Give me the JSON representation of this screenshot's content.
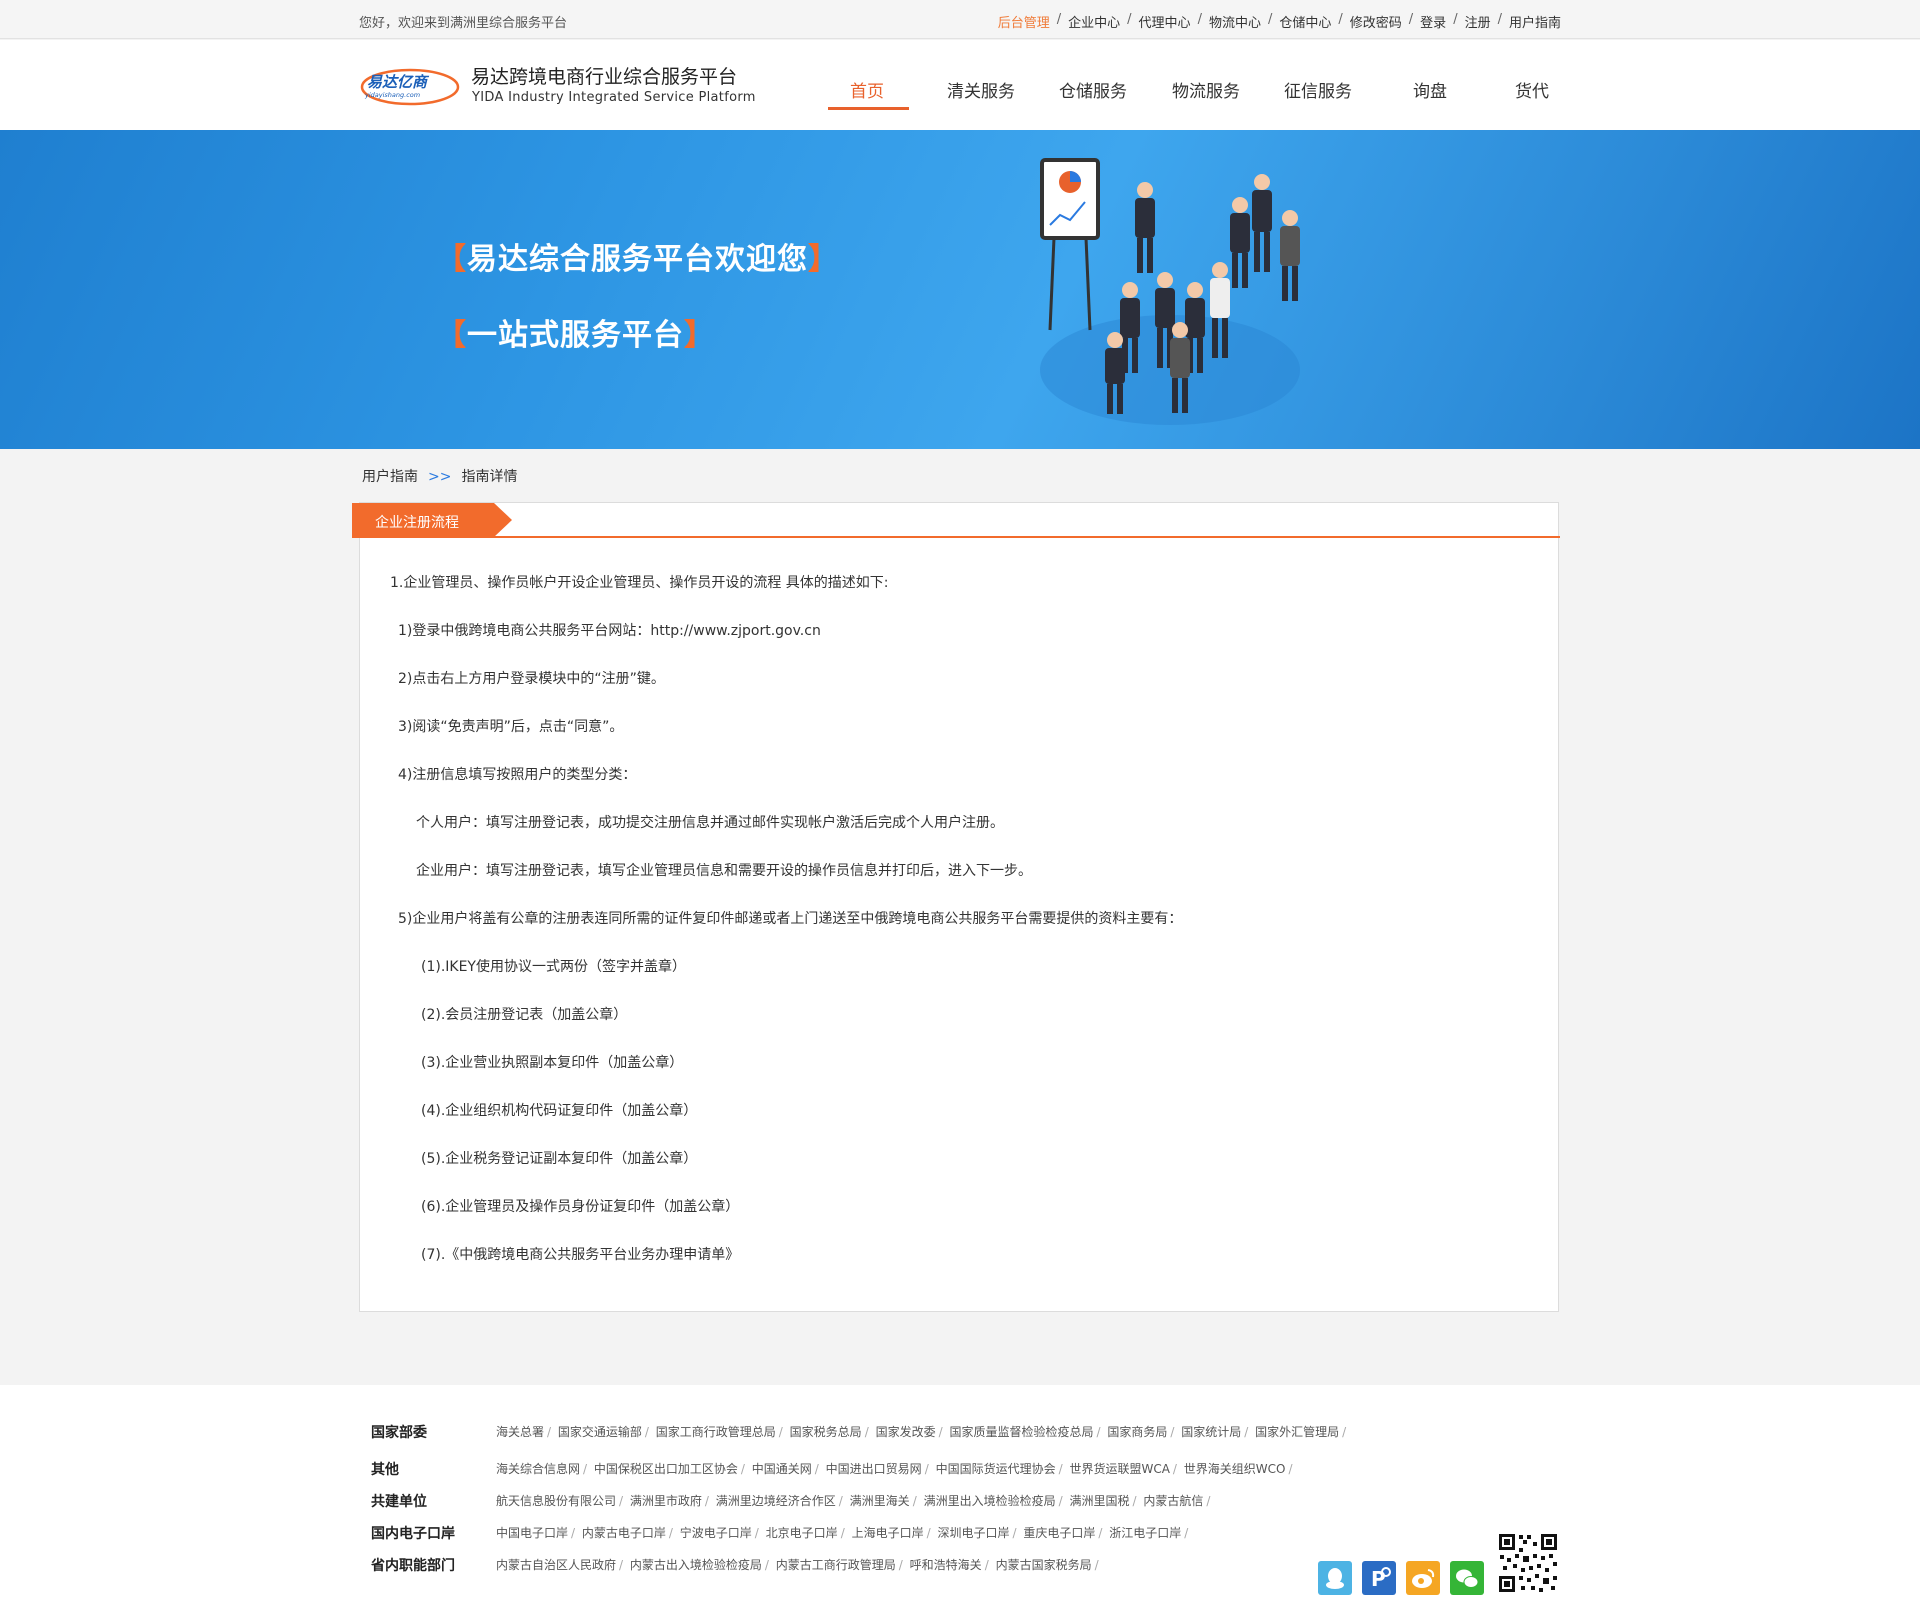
{
  "topbar": {
    "welcome": "您好，欢迎来到满洲里综合服务平台",
    "links": [
      "后台管理",
      "企业中心",
      "代理中心",
      "物流中心",
      "仓储中心",
      "修改密码",
      "登录",
      "注册",
      "用户指南"
    ],
    "active_link_color": "#f07b39"
  },
  "header": {
    "logo_text": "易达亿商",
    "logo_sub": "yidayishang.com",
    "brand_cn": "易达跨境电商行业综合服务平台",
    "brand_en": "YIDA  Industry Integrated Service Platform",
    "nav": [
      "首页",
      "清关服务",
      "仓储服务",
      "物流服务",
      "征信服务",
      "询盘",
      "货代"
    ],
    "active_nav": "首页",
    "accent_color": "#e8612c"
  },
  "banner": {
    "line1": "易达综合服务平台欢迎您",
    "line2": "一站式服务平台",
    "bracket_open": "【",
    "bracket_close": "】"
  },
  "breadcrumb": {
    "item1": "用户指南",
    "separator": ">>",
    "item2": "指南详情"
  },
  "article": {
    "tab_label": "企业注册流程",
    "lines": [
      "1.企业管理员、操作员帐户开设企业管理员、操作员开设的流程 具体的描述如下:",
      "1)登录中俄跨境电商公共服务平台网站：http://www.zjport.gov.cn",
      "2)点击右上方用户登录模块中的“注册”键。",
      "3)阅读“免责声明”后，点击“同意”。",
      "4)注册信息填写按照用户的类型分类：",
      "个人用户：填写注册登记表，成功提交注册信息并通过邮件实现帐户激活后完成个人用户注册。",
      "企业用户：填写注册登记表，填写企业管理员信息和需要开设的操作员信息并打印后，进入下一步。",
      "5)企业用户将盖有公章的注册表连同所需的证件复印件邮递或者上门递送至中俄跨境电商公共服务平台需要提供的资料主要有：",
      "(1).IKEY使用协议一式两份（签字并盖章）",
      "(2).会员注册登记表（加盖公章）",
      "(3).企业营业执照副本复印件（加盖公章）",
      "(4).企业组织机构代码证复印件（加盖公章）",
      "(5).企业税务登记证副本复印件（加盖公章）",
      "(6).企业管理员及操作员身份证复印件（加盖公章）",
      "(7).《中俄跨境电商公共服务平台业务办理申请单》"
    ]
  },
  "footer": {
    "rows": [
      {
        "label": "国家部委",
        "items": [
          "海关总署",
          "国家交通运输部",
          "国家工商行政管理总局",
          "国家税务总局",
          "国家发改委",
          "国家质量监督检验检疫总局",
          "国家商务局",
          "国家统计局",
          "国家外汇管理局"
        ]
      },
      {
        "label": "其他",
        "items": [
          "海关综合信息网",
          "中国保税区出口加工区协会",
          "中国通关网",
          "中国进出口贸易网",
          "中国国际货运代理协会",
          "世界货运联盟WCA",
          "世界海关组织WCO"
        ]
      },
      {
        "label": "共建单位",
        "items": [
          "航天信息股份有限公司",
          "满洲里市政府",
          "满洲里边境经济合作区",
          "满洲里海关",
          "满洲里出入境检验检疫局",
          "满洲里国税",
          "内蒙古航信"
        ]
      },
      {
        "label": "国内电子口岸",
        "items": [
          "中国电子口岸",
          "内蒙古电子口岸",
          "宁波电子口岸",
          "北京电子口岸",
          "上海电子口岸",
          "深圳电子口岸",
          "重庆电子口岸",
          "浙江电子口岸"
        ]
      },
      {
        "label": "省内职能部门",
        "items": [
          "内蒙古自治区人民政府",
          "内蒙古出入境检验检疫局",
          "内蒙古工商行政管理局",
          "呼和浩特海关",
          "内蒙古国家税务局"
        ]
      }
    ],
    "social_icons": [
      "qq-icon",
      "paipai-icon",
      "weibo-icon",
      "wechat-icon"
    ],
    "social_colors": [
      "#4db3e4",
      "#2b6cc4",
      "#f5a623",
      "#35b537"
    ]
  }
}
